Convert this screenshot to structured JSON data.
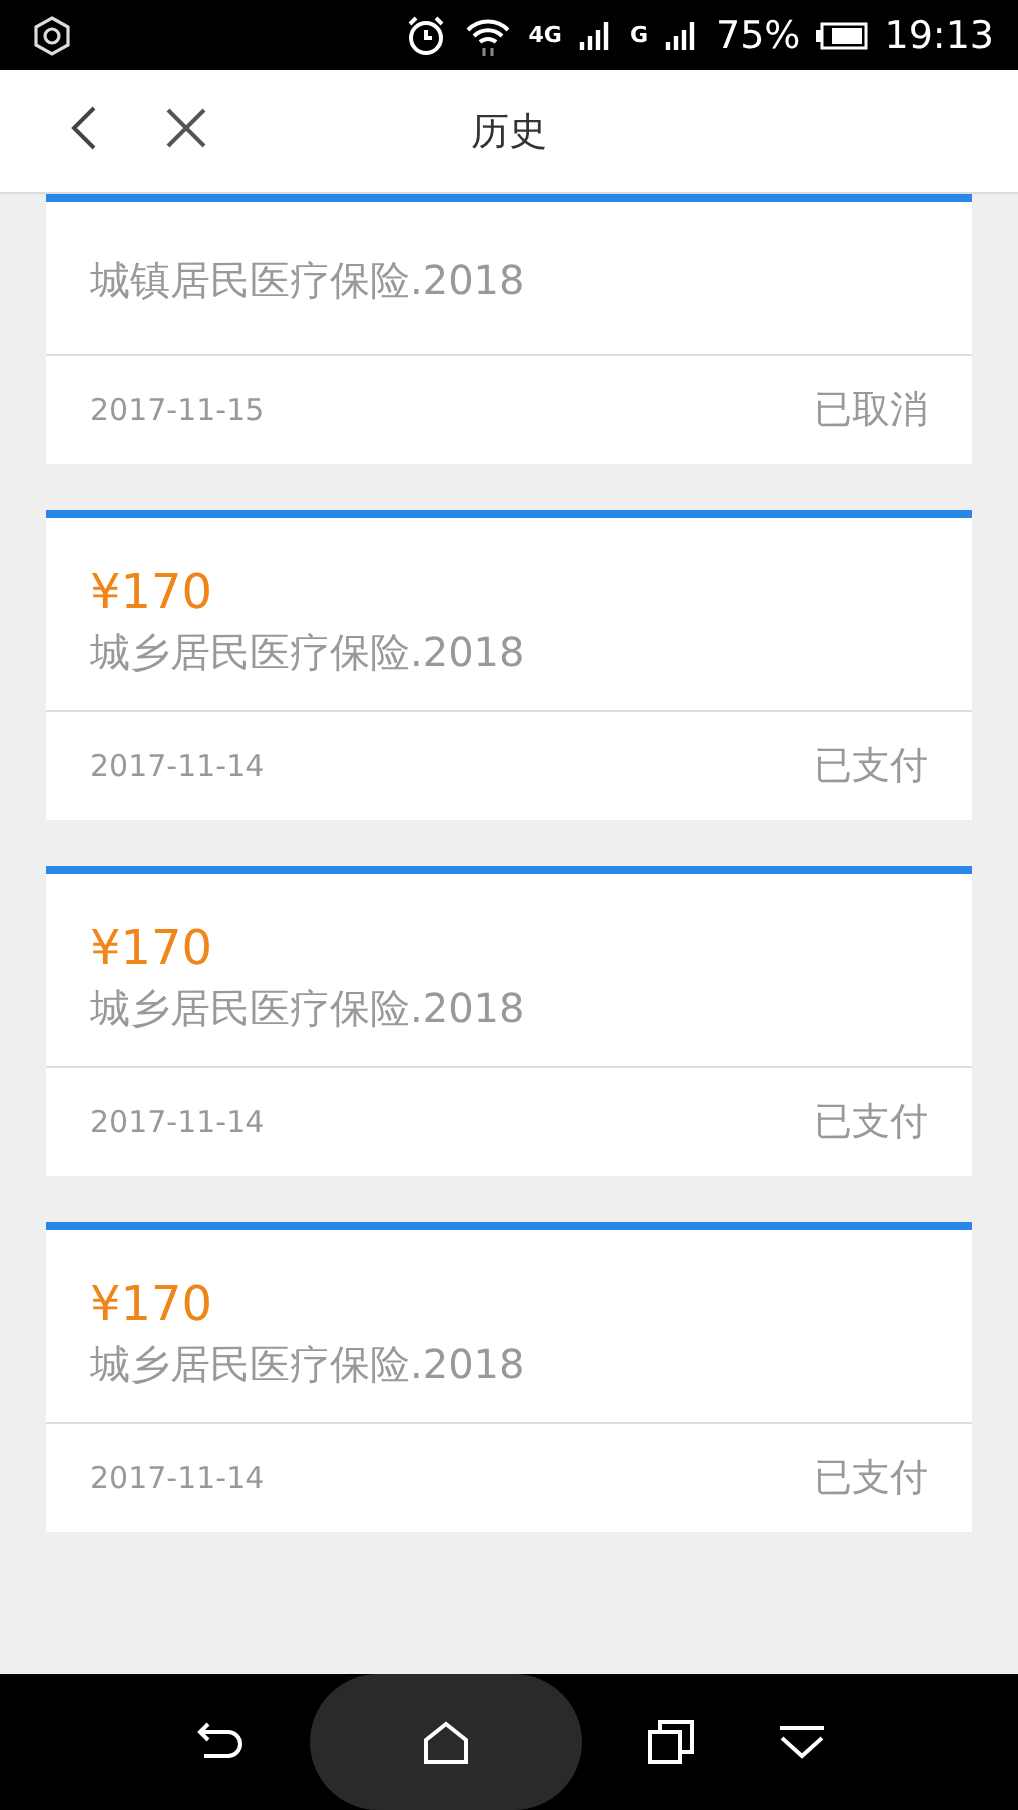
{
  "status_bar": {
    "network_1": "4G",
    "network_2": "G",
    "battery": "75%",
    "time": "19:13"
  },
  "header": {
    "title": "历史"
  },
  "records": [
    {
      "name": "城镇居民医疗保险.2018",
      "date": "2017-11-15",
      "status": "已取消"
    },
    {
      "amount": "¥170",
      "name": "城乡居民医疗保险.2018",
      "date": "2017-11-14",
      "status": "已支付"
    },
    {
      "amount": "¥170",
      "name": "城乡居民医疗保险.2018",
      "date": "2017-11-14",
      "status": "已支付"
    },
    {
      "amount": "¥170",
      "name": "城乡居民医疗保险.2018",
      "date": "2017-11-14",
      "status": "已支付"
    }
  ]
}
